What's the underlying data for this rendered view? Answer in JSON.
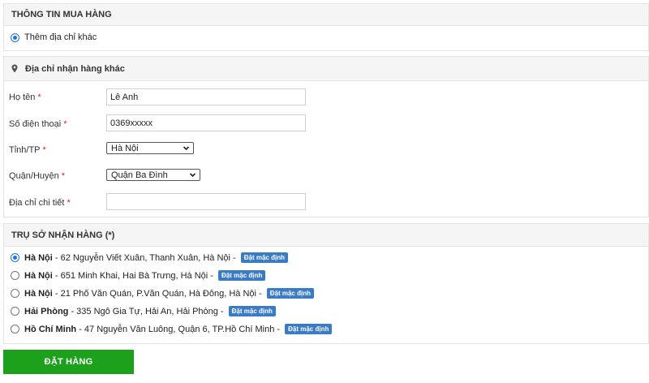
{
  "purchase_info": {
    "title": "THÔNG TIN MUA HÀNG",
    "option_label": "Thêm địa chỉ khác"
  },
  "other_address": {
    "title": "Địa chỉ nhận hàng khác",
    "icon": "map-pin-icon",
    "required_mark": "*",
    "fields": {
      "name": {
        "label": "Họ tên",
        "value": "Lê Anh"
      },
      "phone": {
        "label": "Số điện thoại",
        "value": "0369xxxxx"
      },
      "province": {
        "label": "Tỉnh/TP",
        "selected": "Hà Nội"
      },
      "district": {
        "label": "Quận/Huyện",
        "selected": "Quận Ba Đình"
      },
      "address_detail": {
        "label": "Địa chỉ chi tiết",
        "value": ""
      }
    }
  },
  "offices": {
    "title": "TRỤ SỞ NHẬN HÀNG (*)",
    "badge_label": "Đặt mặc định",
    "items": [
      {
        "city": "Hà Nội",
        "address": " - 62 Nguyễn Viết Xuân, Thanh Xuân, Hà Nội - ",
        "checked": true
      },
      {
        "city": "Hà Nội",
        "address": " - 651 Minh Khai, Hai Bà Trưng, Hà Nội - ",
        "checked": false
      },
      {
        "city": "Hà Nội",
        "address": " - 21 Phố Văn Quán, P.Văn Quán, Hà Đông, Hà Nội - ",
        "checked": false
      },
      {
        "city": "Hải Phòng",
        "address": " - 335 Ngô Gia Tự, Hải An, Hải Phòng - ",
        "checked": false
      },
      {
        "city": "Hồ Chí Minh",
        "address": " - 47 Nguyễn Văn Luông, Quận 6, TP.Hồ Chí Minh - ",
        "checked": false
      }
    ]
  },
  "order_button": {
    "label": "ĐẶT HÀNG"
  },
  "colors": {
    "accent": "#1a73e8",
    "badge": "#3a7bc8",
    "order_button": "#1da11d",
    "required": "#e02020"
  }
}
